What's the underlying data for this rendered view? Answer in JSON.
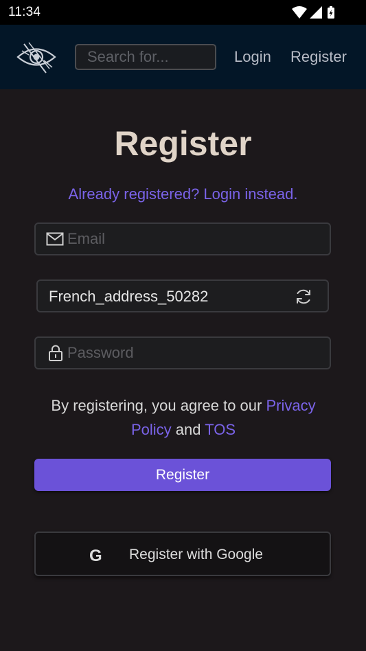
{
  "status_bar": {
    "time": "11:34"
  },
  "nav": {
    "search_placeholder": "Search for...",
    "login_label": "Login",
    "register_label": "Register"
  },
  "form": {
    "title": "Register",
    "login_instead": "Already registered? Login instead.",
    "email_placeholder": "Email",
    "username_value": "French_address_50282",
    "password_placeholder": "Password",
    "terms_prefix": "By registering, you agree to our ",
    "privacy_label": "Privacy Policy",
    "terms_and": " and ",
    "tos_label": "TOS",
    "register_button": "Register",
    "google_button": "Register with Google",
    "google_icon_letter": "G"
  },
  "icons": {
    "logo": "eye-logo-icon",
    "email": "envelope-icon",
    "password": "lock-icon",
    "refresh": "refresh-icon",
    "google": "google-icon"
  },
  "colors": {
    "background": "#1c181b",
    "navbar": "#031627",
    "accent": "#6b52d8",
    "link": "#7a63e8",
    "title": "#e0d4c8"
  }
}
